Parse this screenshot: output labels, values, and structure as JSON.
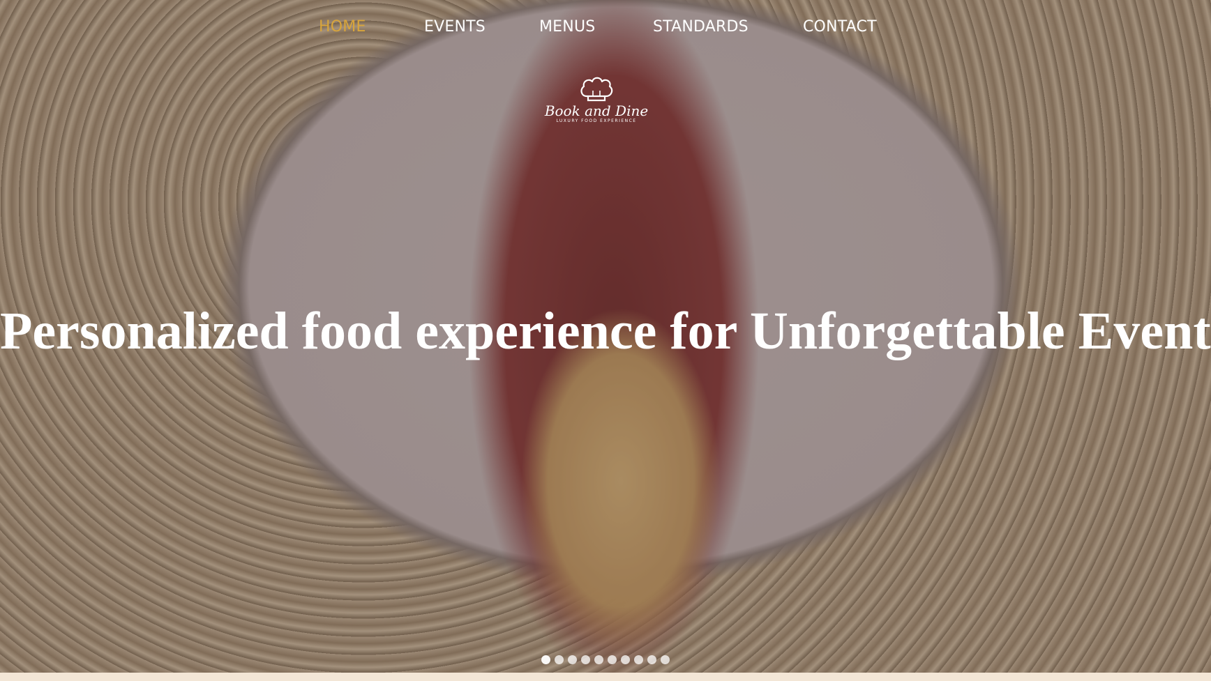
{
  "nav": {
    "items": [
      {
        "label": "HOME",
        "active": true
      },
      {
        "label": "EVENTS",
        "active": false
      },
      {
        "label": "MENUS",
        "active": false
      },
      {
        "label": "STANDARDS",
        "active": false
      },
      {
        "label": "CONTACT",
        "active": false
      }
    ],
    "active_color": "#d8a53c"
  },
  "logo": {
    "name": "Book and Dine",
    "tagline": "Luxury Food Experience",
    "icon": "chef-hat-icon"
  },
  "hero": {
    "headline": "Personalized food experience for Unforgettable Events"
  },
  "slider": {
    "dot_count": 10,
    "active_index": 0
  },
  "colors": {
    "accent": "#d8a53c",
    "footer_strip": "#f3e6d6"
  }
}
